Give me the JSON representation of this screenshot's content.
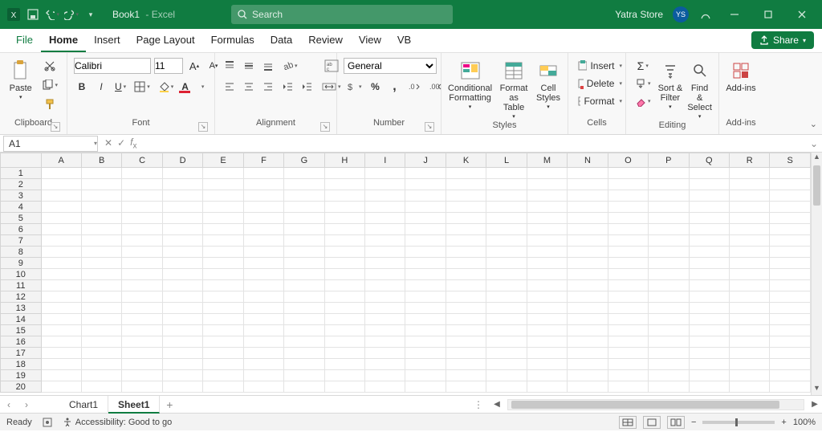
{
  "title": {
    "doc": "Book1",
    "sep": " - ",
    "app": "Excel"
  },
  "search": {
    "placeholder": "Search"
  },
  "account": {
    "name": "Yatra Store",
    "initials": "YS"
  },
  "share": {
    "label": "Share"
  },
  "tabs": {
    "file": "File",
    "home": "Home",
    "insert": "Insert",
    "pagelayout": "Page Layout",
    "formulas": "Formulas",
    "data": "Data",
    "review": "Review",
    "view": "View",
    "vb": "VB",
    "active": "Home"
  },
  "ribbon": {
    "clipboard": {
      "label": "Clipboard",
      "paste": "Paste"
    },
    "font": {
      "label": "Font",
      "name": "Calibri",
      "size": "11"
    },
    "alignment": {
      "label": "Alignment"
    },
    "number": {
      "label": "Number",
      "format": "General"
    },
    "styles": {
      "label": "Styles",
      "conditional": "Conditional\nFormatting",
      "table": "Format as\nTable",
      "cell": "Cell\nStyles"
    },
    "cells": {
      "label": "Cells",
      "insert": "Insert",
      "delete": "Delete",
      "format": "Format"
    },
    "editing": {
      "label": "Editing",
      "sort": "Sort &\nFilter",
      "find": "Find &\nSelect"
    },
    "addins": {
      "label": "Add-ins",
      "btn": "Add-ins"
    }
  },
  "namebox": {
    "value": "A1"
  },
  "grid": {
    "columns": [
      "A",
      "B",
      "C",
      "D",
      "E",
      "F",
      "G",
      "H",
      "I",
      "J",
      "K",
      "L",
      "M",
      "N",
      "O",
      "P",
      "Q",
      "R",
      "S"
    ],
    "rows": 20
  },
  "sheets": {
    "items": [
      "Chart1",
      "Sheet1"
    ],
    "active": "Sheet1"
  },
  "status": {
    "ready": "Ready",
    "accessibility": "Accessibility: Good to go",
    "zoom": "100%"
  }
}
